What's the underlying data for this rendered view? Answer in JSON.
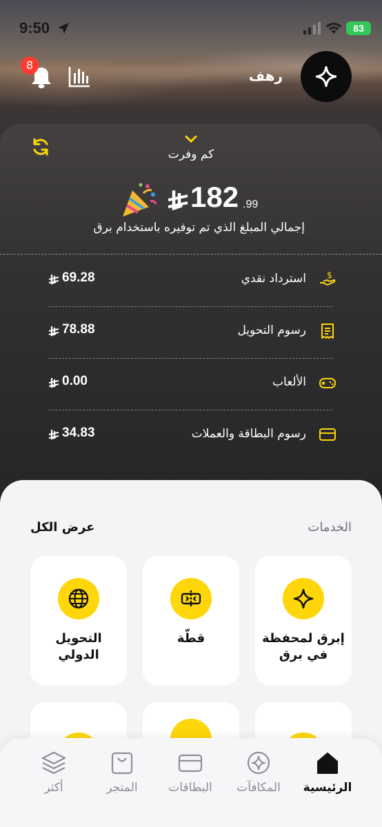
{
  "status_bar": {
    "time": "9:50",
    "battery": "83"
  },
  "header": {
    "notification_count": "8",
    "user_name": "رهف"
  },
  "savings": {
    "toggle_label": "كم وفرت",
    "total_integer": "182",
    "total_decimal": ".99",
    "caption": "إجمالي المبلغ الذي تم توفيره باستخدام برق",
    "rows": [
      {
        "label": "استرداد نقدي",
        "value": "69.28",
        "icon": "cash-hand-icon"
      },
      {
        "label": "رسوم التحويل",
        "value": "78.88",
        "icon": "receipt-icon"
      },
      {
        "label": "الألعاب",
        "value": "0.00",
        "icon": "gamepad-icon"
      },
      {
        "label": "رسوم البطاقة والعملات",
        "value": "34.83",
        "icon": "card-icon"
      }
    ]
  },
  "services": {
    "title": "الخدمات",
    "view_all": "عرض الكل",
    "items": [
      {
        "label": "إبرق لمحفظة في برق",
        "icon": "sparkle-icon"
      },
      {
        "label": "قطّة",
        "icon": "split-icon"
      },
      {
        "label": "التحويل الدولي",
        "icon": "globe-icon"
      }
    ]
  },
  "bottom_nav": {
    "items": [
      {
        "label": "الرئيسية",
        "icon": "home-icon",
        "active": true
      },
      {
        "label": "المكافآت",
        "icon": "compass-icon"
      },
      {
        "label": "البطاقات",
        "icon": "card-icon"
      },
      {
        "label": "المتجر",
        "icon": "bag-icon"
      },
      {
        "label": "أكثر",
        "icon": "layers-icon"
      }
    ]
  },
  "colors": {
    "accent": "#ffd60a",
    "badge": "#ff3b30",
    "battery": "#35c759"
  }
}
